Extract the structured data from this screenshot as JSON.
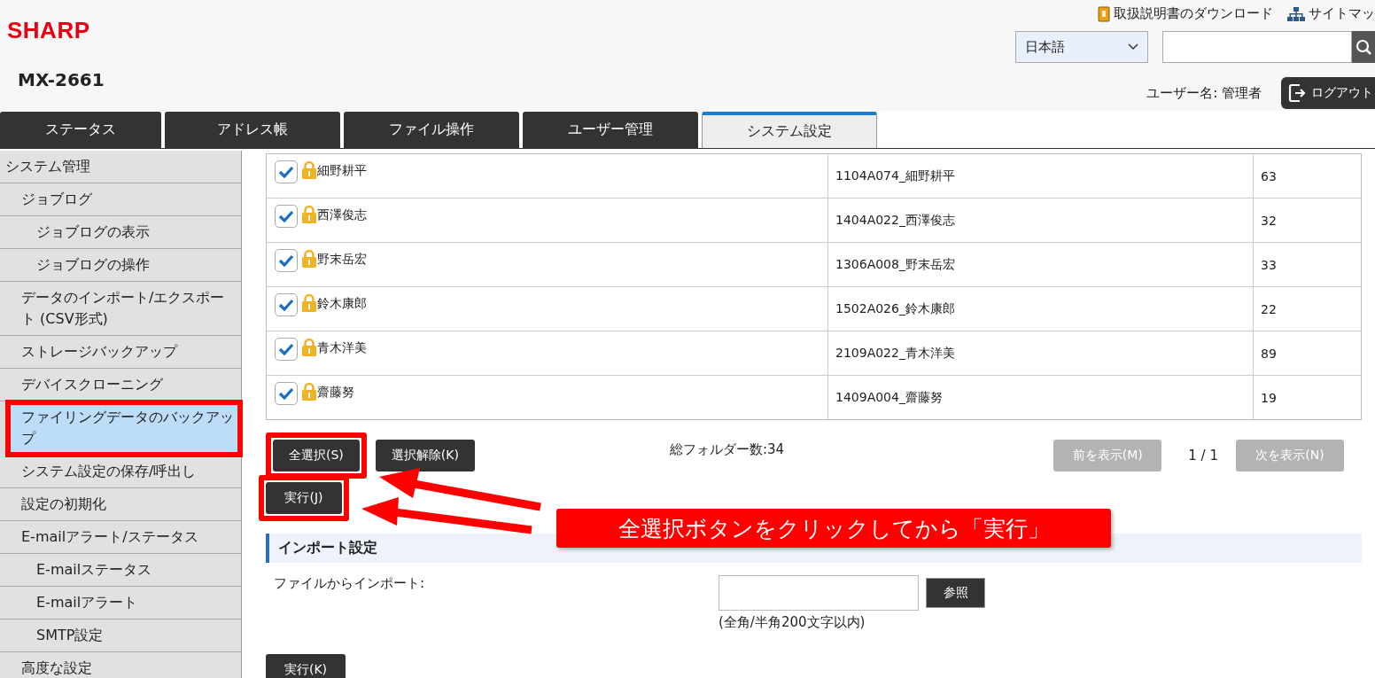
{
  "header": {
    "logo": "SHARP",
    "model": "MX-2661",
    "links": [
      {
        "kind": "manual",
        "label": "取扱説明書のダウンロード"
      },
      {
        "kind": "sitemap",
        "label": "サイトマッ"
      }
    ],
    "language": "日本語",
    "user_label": "ユーザー名: 管理者",
    "logout": "ログアウト"
  },
  "tabs": [
    {
      "label": "ステータス",
      "selected": false
    },
    {
      "label": "アドレス帳",
      "selected": false
    },
    {
      "label": "ファイル操作",
      "selected": false
    },
    {
      "label": "ユーザー管理",
      "selected": false
    },
    {
      "label": "システム設定",
      "selected": true
    }
  ],
  "sidebar": {
    "items": [
      {
        "label": "システム管理",
        "selected": false,
        "highlighted": false,
        "children": [
          {
            "label": "ジョブログ",
            "selected": false,
            "highlighted": false,
            "children": [
              {
                "label": "ジョブログの表示",
                "selected": false,
                "highlighted": false
              },
              {
                "label": "ジョブログの操作",
                "selected": false,
                "highlighted": false
              }
            ]
          },
          {
            "label": "データのインポート/エクスポート (CSV形式)",
            "selected": false,
            "highlighted": false
          },
          {
            "label": "ストレージバックアップ",
            "selected": false,
            "highlighted": false
          },
          {
            "label": "デバイスクローニング",
            "selected": false,
            "highlighted": false
          },
          {
            "label": "ファイリングデータのバックアップ",
            "selected": true,
            "highlighted": true
          },
          {
            "label": "システム設定の保存/呼出し",
            "selected": false,
            "highlighted": false
          },
          {
            "label": "設定の初期化",
            "selected": false,
            "highlighted": false
          },
          {
            "label": "E-mailアラート/ステータス",
            "selected": false,
            "highlighted": false,
            "children": [
              {
                "label": "E-mailステータス",
                "selected": false,
                "highlighted": false
              },
              {
                "label": "E-mailアラート",
                "selected": false,
                "highlighted": false
              },
              {
                "label": "SMTP設定",
                "selected": false,
                "highlighted": false
              }
            ]
          },
          {
            "label": "高度な設定",
            "selected": false,
            "highlighted": false
          }
        ]
      }
    ]
  },
  "table": {
    "rows": [
      {
        "checked": true,
        "locked": true,
        "name": "細野耕平",
        "folder": "1104A074_細野耕平",
        "count": "63"
      },
      {
        "checked": true,
        "locked": true,
        "name": "西澤俊志",
        "folder": "1404A022_西澤俊志",
        "count": "32"
      },
      {
        "checked": true,
        "locked": true,
        "name": "野末岳宏",
        "folder": "1306A008_野末岳宏",
        "count": "33"
      },
      {
        "checked": true,
        "locked": true,
        "name": "鈴木康郎",
        "folder": "1502A026_鈴木康郎",
        "count": "22"
      },
      {
        "checked": true,
        "locked": true,
        "name": "青木洋美",
        "folder": "2109A022_青木洋美",
        "count": "89"
      },
      {
        "checked": true,
        "locked": true,
        "name": "齋藤努",
        "folder": "1409A004_齋藤努",
        "count": "19"
      }
    ]
  },
  "selection_buttons": [
    {
      "label": "全選択(S)",
      "highlighted": true
    },
    {
      "label": "選択解除(K)",
      "highlighted": false
    }
  ],
  "total_folders": "総フォルダー数:34",
  "pagination": {
    "prev": {
      "label": "前を表示(M)",
      "disabled": true
    },
    "page": "1 / 1",
    "next": {
      "label": "次を表示(N)",
      "disabled": true
    }
  },
  "execute_button": {
    "label": "実行(J)",
    "highlighted": true
  },
  "import": {
    "title": "インポート設定",
    "label": "ファイルからインポート:",
    "browse": "参照",
    "hint": "(全角/半角200文字以内)",
    "execute": "実行(K)"
  },
  "annotation": {
    "callout": "全選択ボタンをクリックしてから「実行」"
  }
}
